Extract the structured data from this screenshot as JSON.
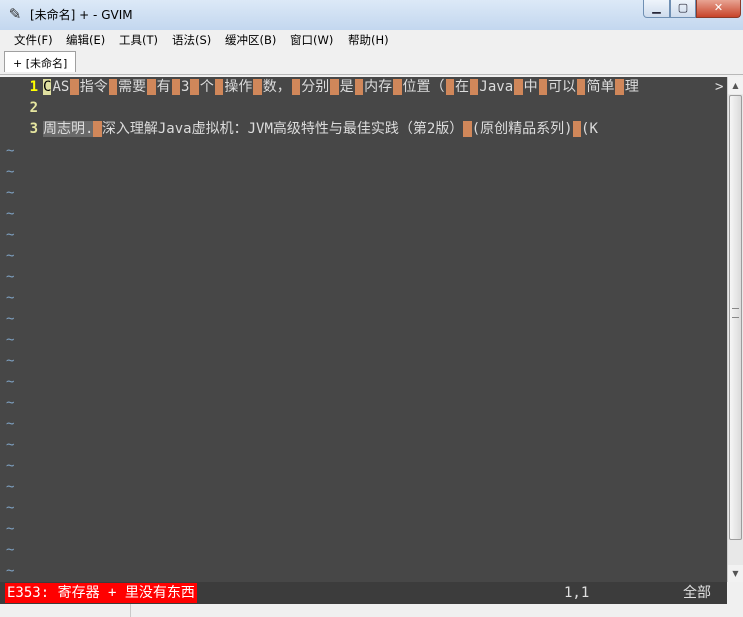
{
  "window": {
    "title": "[未命名] + - GVIM",
    "app_icon": "vim-icon",
    "buttons": {
      "minimize": "▁",
      "maximize": "▢",
      "close": "✕"
    }
  },
  "menu": {
    "items": [
      "文件(F)",
      "编辑(E)",
      "工具(T)",
      "语法(S)",
      "缓冲区(B)",
      "窗口(W)",
      "帮助(H)"
    ]
  },
  "tabs": [
    {
      "label": "+ [未命名]"
    }
  ],
  "editor": {
    "line_numbers": [
      "1",
      "2",
      "3"
    ],
    "line1_tokens": [
      "AS",
      "指令",
      "需要",
      "有",
      "3",
      "个",
      "操作",
      "数，",
      "分别",
      "是",
      "内存",
      "位置（",
      "在",
      "Java",
      "中",
      "可以",
      "简单",
      "理"
    ],
    "line1_cursor_char": "C",
    "line1_more_marker": ">",
    "line3": {
      "author": "周志明.",
      "title": "深入理解Java虚拟机：JVM高级特性与最佳实践（第2版）",
      "series": "(原创精品系列)",
      "tail": "(K"
    },
    "tilde": "~"
  },
  "statusline": {
    "error": "E353: 寄存器 + 里没有东西",
    "position": "1,1",
    "scroll": "全部"
  },
  "colors": {
    "editor_bg": "#474747",
    "highlight": "#d0875a",
    "line_number": "#e6e6a0",
    "error_bg": "#ff0000",
    "tilde": "#7ea0c0"
  }
}
